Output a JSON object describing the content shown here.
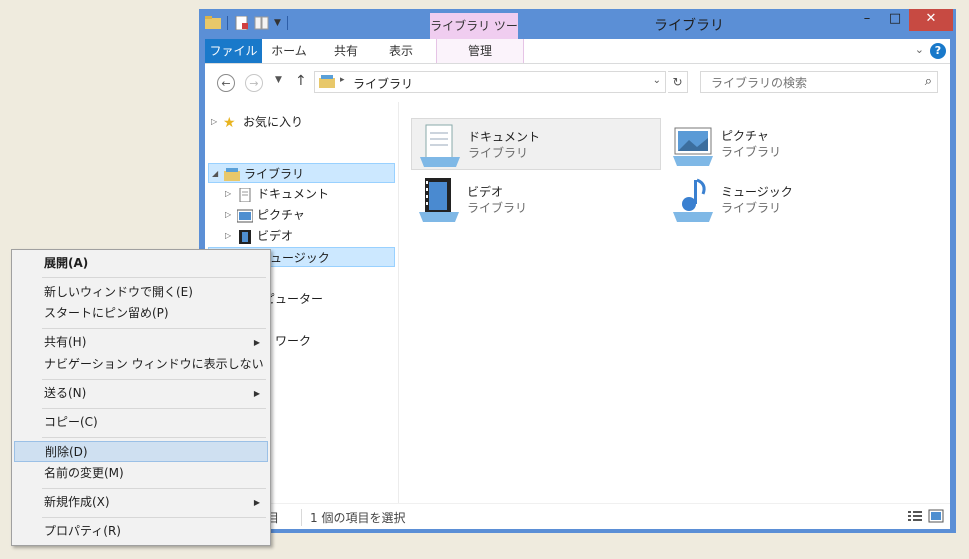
{
  "window": {
    "title": "ライブラリ",
    "context_tab_header": "ライブラリ ツール",
    "controls": {
      "minimize": "–",
      "maximize": "□",
      "close": "✕"
    }
  },
  "ribbon": {
    "tabs": [
      "ファイル",
      "ホーム",
      "共有",
      "表示",
      "管理"
    ],
    "help": "?"
  },
  "address": {
    "path": "ライブラリ",
    "search_placeholder": "ライブラリの検索"
  },
  "nav_tree": {
    "favorites": "お気に入り",
    "libraries": "ライブラリ",
    "documents": "ドキュメント",
    "pictures": "ピクチャ",
    "videos": "ビデオ",
    "music": "ミュージック",
    "computer_partial": "ピューター",
    "network_partial": "ワーク"
  },
  "tiles": [
    {
      "name": "ドキュメント",
      "sub": "ライブラリ"
    },
    {
      "name": "ピクチャ",
      "sub": "ライブラリ"
    },
    {
      "name": "ビデオ",
      "sub": "ライブラリ"
    },
    {
      "name": "ミュージック",
      "sub": "ライブラリ"
    }
  ],
  "status": {
    "items_partial": "目",
    "selected": "1 個の項目を選択"
  },
  "context_menu": {
    "expand": "展開(A)",
    "open_new_window": "新しいウィンドウで開く(E)",
    "pin_start": "スタートにピン留め(P)",
    "share": "共有(H)",
    "hide_nav": "ナビゲーション ウィンドウに表示しない",
    "send_to": "送る(N)",
    "copy": "コピー(C)",
    "delete": "削除(D)",
    "rename": "名前の変更(M)",
    "new": "新規作成(X)",
    "properties": "プロパティ(R)"
  },
  "colors": {
    "window_frame": "#5b8fd6",
    "file_tab": "#1979ca",
    "context_tab": "#f0cdf0",
    "close_button": "#c74a42",
    "selection": "#cce8ff",
    "menu_highlight": "#cfe0f1",
    "desktop": "#efebde"
  }
}
